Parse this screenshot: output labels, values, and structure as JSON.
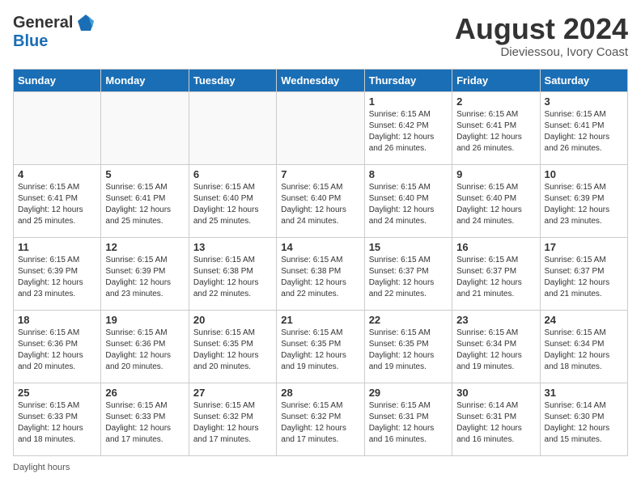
{
  "header": {
    "logo_general": "General",
    "logo_blue": "Blue",
    "month_year": "August 2024",
    "location": "Dieviessou, Ivory Coast"
  },
  "calendar": {
    "days_of_week": [
      "Sunday",
      "Monday",
      "Tuesday",
      "Wednesday",
      "Thursday",
      "Friday",
      "Saturday"
    ],
    "weeks": [
      [
        {
          "day": "",
          "info": ""
        },
        {
          "day": "",
          "info": ""
        },
        {
          "day": "",
          "info": ""
        },
        {
          "day": "",
          "info": ""
        },
        {
          "day": "1",
          "info": "Sunrise: 6:15 AM\nSunset: 6:42 PM\nDaylight: 12 hours\nand 26 minutes."
        },
        {
          "day": "2",
          "info": "Sunrise: 6:15 AM\nSunset: 6:41 PM\nDaylight: 12 hours\nand 26 minutes."
        },
        {
          "day": "3",
          "info": "Sunrise: 6:15 AM\nSunset: 6:41 PM\nDaylight: 12 hours\nand 26 minutes."
        }
      ],
      [
        {
          "day": "4",
          "info": "Sunrise: 6:15 AM\nSunset: 6:41 PM\nDaylight: 12 hours\nand 25 minutes."
        },
        {
          "day": "5",
          "info": "Sunrise: 6:15 AM\nSunset: 6:41 PM\nDaylight: 12 hours\nand 25 minutes."
        },
        {
          "day": "6",
          "info": "Sunrise: 6:15 AM\nSunset: 6:40 PM\nDaylight: 12 hours\nand 25 minutes."
        },
        {
          "day": "7",
          "info": "Sunrise: 6:15 AM\nSunset: 6:40 PM\nDaylight: 12 hours\nand 24 minutes."
        },
        {
          "day": "8",
          "info": "Sunrise: 6:15 AM\nSunset: 6:40 PM\nDaylight: 12 hours\nand 24 minutes."
        },
        {
          "day": "9",
          "info": "Sunrise: 6:15 AM\nSunset: 6:40 PM\nDaylight: 12 hours\nand 24 minutes."
        },
        {
          "day": "10",
          "info": "Sunrise: 6:15 AM\nSunset: 6:39 PM\nDaylight: 12 hours\nand 23 minutes."
        }
      ],
      [
        {
          "day": "11",
          "info": "Sunrise: 6:15 AM\nSunset: 6:39 PM\nDaylight: 12 hours\nand 23 minutes."
        },
        {
          "day": "12",
          "info": "Sunrise: 6:15 AM\nSunset: 6:39 PM\nDaylight: 12 hours\nand 23 minutes."
        },
        {
          "day": "13",
          "info": "Sunrise: 6:15 AM\nSunset: 6:38 PM\nDaylight: 12 hours\nand 22 minutes."
        },
        {
          "day": "14",
          "info": "Sunrise: 6:15 AM\nSunset: 6:38 PM\nDaylight: 12 hours\nand 22 minutes."
        },
        {
          "day": "15",
          "info": "Sunrise: 6:15 AM\nSunset: 6:37 PM\nDaylight: 12 hours\nand 22 minutes."
        },
        {
          "day": "16",
          "info": "Sunrise: 6:15 AM\nSunset: 6:37 PM\nDaylight: 12 hours\nand 21 minutes."
        },
        {
          "day": "17",
          "info": "Sunrise: 6:15 AM\nSunset: 6:37 PM\nDaylight: 12 hours\nand 21 minutes."
        }
      ],
      [
        {
          "day": "18",
          "info": "Sunrise: 6:15 AM\nSunset: 6:36 PM\nDaylight: 12 hours\nand 20 minutes."
        },
        {
          "day": "19",
          "info": "Sunrise: 6:15 AM\nSunset: 6:36 PM\nDaylight: 12 hours\nand 20 minutes."
        },
        {
          "day": "20",
          "info": "Sunrise: 6:15 AM\nSunset: 6:35 PM\nDaylight: 12 hours\nand 20 minutes."
        },
        {
          "day": "21",
          "info": "Sunrise: 6:15 AM\nSunset: 6:35 PM\nDaylight: 12 hours\nand 19 minutes."
        },
        {
          "day": "22",
          "info": "Sunrise: 6:15 AM\nSunset: 6:35 PM\nDaylight: 12 hours\nand 19 minutes."
        },
        {
          "day": "23",
          "info": "Sunrise: 6:15 AM\nSunset: 6:34 PM\nDaylight: 12 hours\nand 19 minutes."
        },
        {
          "day": "24",
          "info": "Sunrise: 6:15 AM\nSunset: 6:34 PM\nDaylight: 12 hours\nand 18 minutes."
        }
      ],
      [
        {
          "day": "25",
          "info": "Sunrise: 6:15 AM\nSunset: 6:33 PM\nDaylight: 12 hours\nand 18 minutes."
        },
        {
          "day": "26",
          "info": "Sunrise: 6:15 AM\nSunset: 6:33 PM\nDaylight: 12 hours\nand 17 minutes."
        },
        {
          "day": "27",
          "info": "Sunrise: 6:15 AM\nSunset: 6:32 PM\nDaylight: 12 hours\nand 17 minutes."
        },
        {
          "day": "28",
          "info": "Sunrise: 6:15 AM\nSunset: 6:32 PM\nDaylight: 12 hours\nand 17 minutes."
        },
        {
          "day": "29",
          "info": "Sunrise: 6:15 AM\nSunset: 6:31 PM\nDaylight: 12 hours\nand 16 minutes."
        },
        {
          "day": "30",
          "info": "Sunrise: 6:14 AM\nSunset: 6:31 PM\nDaylight: 12 hours\nand 16 minutes."
        },
        {
          "day": "31",
          "info": "Sunrise: 6:14 AM\nSunset: 6:30 PM\nDaylight: 12 hours\nand 15 minutes."
        }
      ]
    ]
  },
  "footer": {
    "note": "Daylight hours"
  }
}
